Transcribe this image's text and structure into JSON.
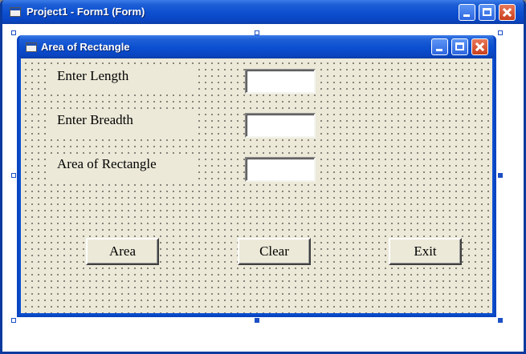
{
  "outer_window": {
    "title": "Project1 - Form1 (Form)"
  },
  "form": {
    "title": "Area of Rectangle",
    "labels": {
      "length": "Enter Length",
      "breadth": "Enter Breadth",
      "area": "Area of Rectangle"
    },
    "inputs": {
      "length": "",
      "breadth": "",
      "area": ""
    },
    "buttons": {
      "area": "Area",
      "clear": "Clear",
      "exit": "Exit"
    }
  },
  "colors": {
    "titlebar": "#0b4fd0",
    "form_background": "#ece9d8",
    "close_button": "#c9401c"
  },
  "icons": {
    "title_icon": "form-window-icon",
    "minimize": "minimize-icon",
    "maximize": "maximize-icon",
    "close": "close-icon"
  }
}
